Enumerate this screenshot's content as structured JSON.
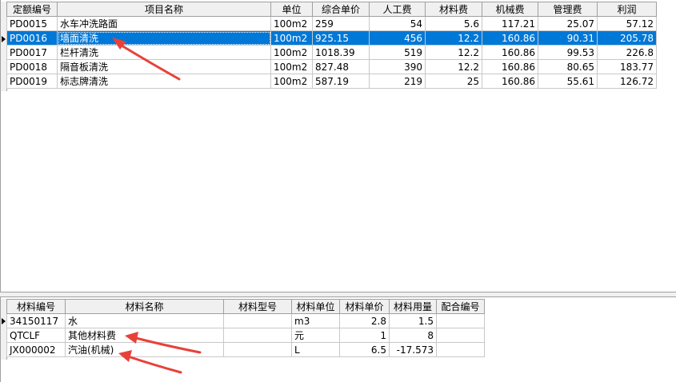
{
  "projects": {
    "headers": [
      "定额编号",
      "项目名称",
      "单位",
      "综合单价",
      "人工费",
      "材料费",
      "机械费",
      "管理费",
      "利润"
    ],
    "rows": [
      {
        "code": "PD0015",
        "name": "水车冲洗路面",
        "unit": "100m2",
        "price": "259",
        "labor": "54",
        "material": "5.6",
        "machine": "117.21",
        "mgmt": "25.07",
        "profit": "57.12"
      },
      {
        "code": "PD0016",
        "name": "墙面清洗",
        "unit": "100m2",
        "price": "925.15",
        "labor": "456",
        "material": "12.2",
        "machine": "160.86",
        "mgmt": "90.31",
        "profit": "205.78"
      },
      {
        "code": "PD0017",
        "name": "栏杆清洗",
        "unit": "100m2",
        "price": "1018.39",
        "labor": "519",
        "material": "12.2",
        "machine": "160.86",
        "mgmt": "99.53",
        "profit": "226.8"
      },
      {
        "code": "PD0018",
        "name": "隔音板清洗",
        "unit": "100m2",
        "price": "827.48",
        "labor": "390",
        "material": "12.2",
        "machine": "160.86",
        "mgmt": "80.65",
        "profit": "183.77"
      },
      {
        "code": "PD0019",
        "name": "标志牌清洗",
        "unit": "100m2",
        "price": "587.19",
        "labor": "219",
        "material": "25",
        "machine": "160.86",
        "mgmt": "55.61",
        "profit": "126.72"
      }
    ],
    "selected_row": 1
  },
  "materials": {
    "headers": [
      "材料编号",
      "材料名称",
      "材料型号",
      "材料单位",
      "材料单价",
      "材料用量",
      "配合编号"
    ],
    "rows": [
      {
        "code": "34150117",
        "name": "水",
        "model": "",
        "unit": "m3",
        "price": "2.8",
        "qty": "1.5",
        "mix": ""
      },
      {
        "code": "QTCLF",
        "name": "其他材料费",
        "model": "",
        "unit": "元",
        "price": "1",
        "qty": "8",
        "mix": ""
      },
      {
        "code": "JX000002",
        "name": "汽油(机械)",
        "model": "",
        "unit": "L",
        "price": "6.5",
        "qty": "-17.573",
        "mix": ""
      }
    ],
    "current_row": 0
  },
  "colors": {
    "selection": "#0078d7",
    "annotation_arrow": "#e8413a",
    "header_bg": "#f0f0f0"
  }
}
